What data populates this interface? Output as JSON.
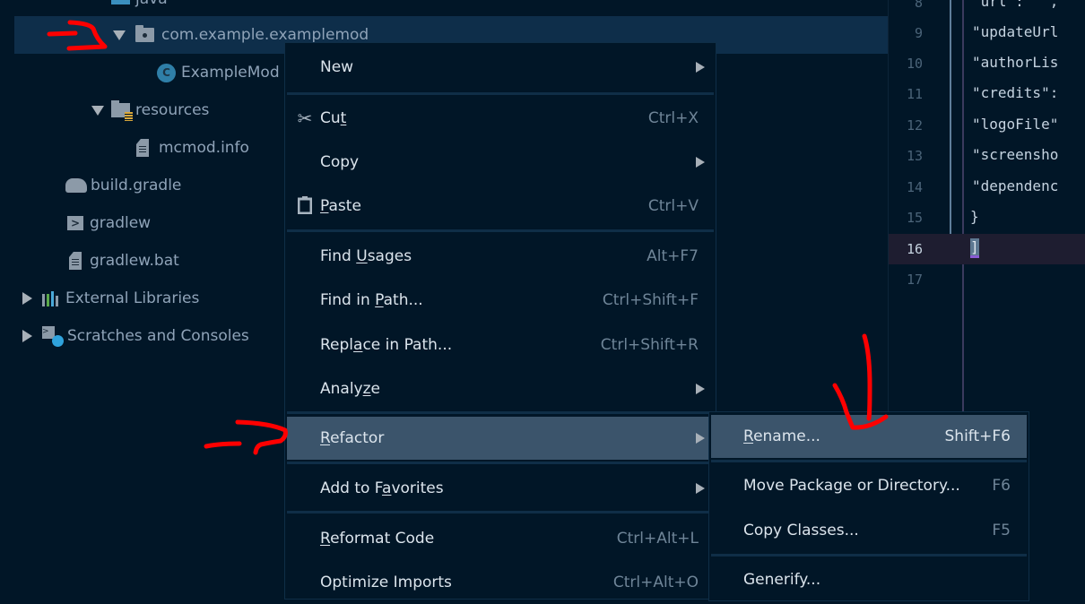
{
  "tree": {
    "items": [
      {
        "label": "java",
        "icon": "java-source-folder-icon",
        "expanded": true
      },
      {
        "label": "com.example.examplemod",
        "icon": "package-icon",
        "expanded": true,
        "selected": true
      },
      {
        "label": "ExampleMod",
        "icon": "class-icon",
        "icon_glyph": "C"
      },
      {
        "label": "resources",
        "icon": "resources-folder-icon",
        "expanded": true
      },
      {
        "label": "mcmod.info",
        "icon": "file-icon"
      },
      {
        "label": "build.gradle",
        "icon": "gradle-elephant-icon"
      },
      {
        "label": "gradlew",
        "icon": "terminal-script-icon",
        "icon_glyph": ">"
      },
      {
        "label": "gradlew.bat",
        "icon": "file-icon"
      },
      {
        "label": "External Libraries",
        "icon": "libraries-icon",
        "expanded": false
      },
      {
        "label": "Scratches and Consoles",
        "icon": "scratches-icon",
        "expanded": false
      }
    ]
  },
  "editor": {
    "lines": [
      {
        "number": "8",
        "code": "\"url\": \"\","
      },
      {
        "number": "9",
        "code": "\"updateUrl"
      },
      {
        "number": "10",
        "code": "\"authorLis"
      },
      {
        "number": "11",
        "code": "\"credits\":"
      },
      {
        "number": "12",
        "code": "\"logoFile\""
      },
      {
        "number": "13",
        "code": "\"screensho"
      },
      {
        "number": "14",
        "code": "\"dependenc"
      },
      {
        "number": "15",
        "code": "}"
      },
      {
        "number": "16",
        "code": "]",
        "current": true
      },
      {
        "number": "17",
        "code": ""
      }
    ]
  },
  "context_menu": {
    "items": [
      {
        "label": "New",
        "submenu": true
      },
      {
        "label": "Cut",
        "mnemonic": "t",
        "shortcut": "Ctrl+X",
        "icon": "scissors-icon"
      },
      {
        "label": "Copy",
        "submenu": true
      },
      {
        "label": "Paste",
        "mnemonic": "P",
        "shortcut": "Ctrl+V",
        "icon": "clipboard-icon"
      },
      {
        "label": "Find Usages",
        "mnemonic": "U",
        "shortcut": "Alt+F7"
      },
      {
        "label": "Find in Path...",
        "mnemonic": "P",
        "shortcut": "Ctrl+Shift+F"
      },
      {
        "label": "Replace in Path...",
        "mnemonic": "a",
        "shortcut": "Ctrl+Shift+R"
      },
      {
        "label": "Analyze",
        "mnemonic": "z",
        "submenu": true
      },
      {
        "label": "Refactor",
        "mnemonic": "R",
        "submenu": true,
        "highlighted": true
      },
      {
        "label": "Add to Favorites",
        "mnemonic": "a",
        "submenu": true
      },
      {
        "label": "Reformat Code",
        "mnemonic": "R",
        "shortcut": "Ctrl+Alt+L"
      },
      {
        "label": "Optimize Imports",
        "shortcut": "Ctrl+Alt+O"
      }
    ]
  },
  "refactor_submenu": {
    "items": [
      {
        "label": "Rename...",
        "mnemonic": "R",
        "shortcut": "Shift+F6",
        "highlighted": true
      },
      {
        "label": "Move Package or Directory...",
        "shortcut": "F6"
      },
      {
        "label": "Copy Classes...",
        "shortcut": "F5"
      },
      {
        "label": "Generify..."
      }
    ]
  },
  "annotations": {
    "color": "#ff0000",
    "marks": [
      "arrow-to-package",
      "arrow-to-refactor",
      "arrow-to-rename"
    ]
  },
  "colors": {
    "background": "#011627",
    "selection": "#0e2e4a",
    "menu_highlight": "#3b546b",
    "current_line": "#1e1d30"
  }
}
